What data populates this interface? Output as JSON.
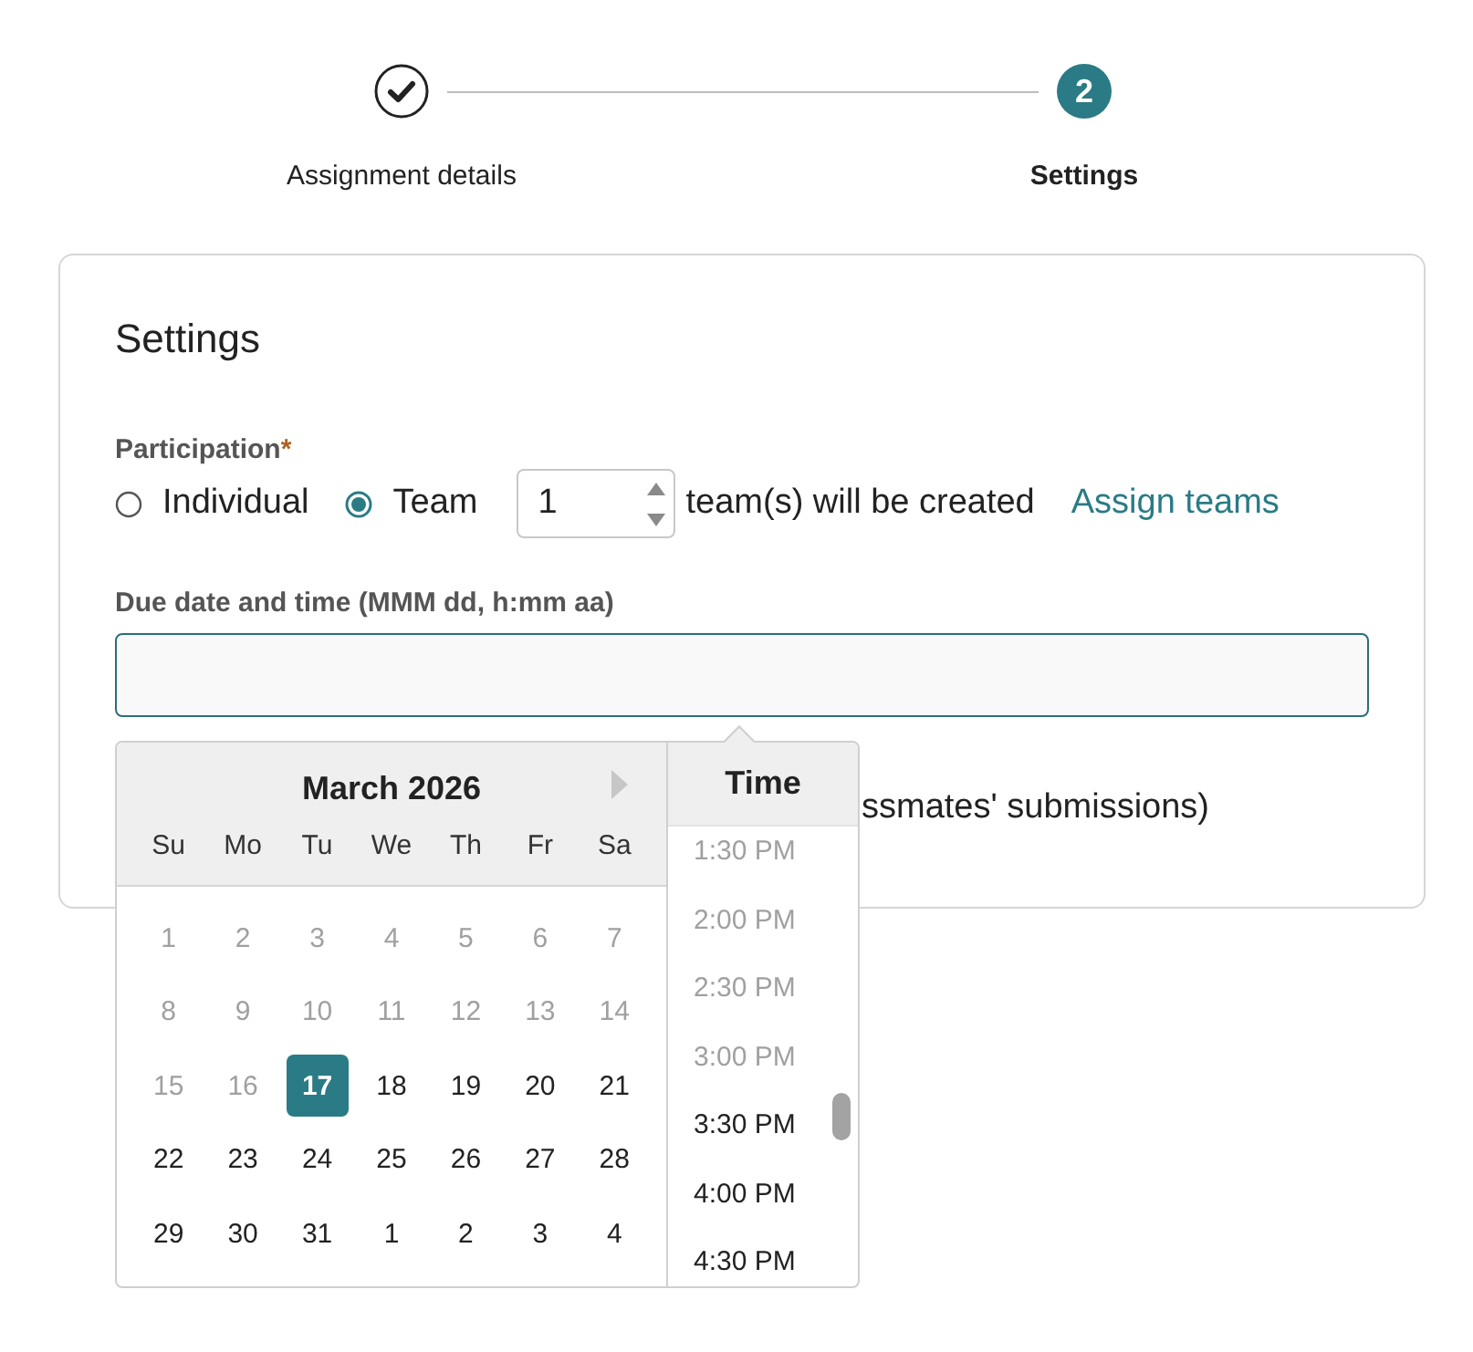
{
  "stepper": {
    "steps": [
      {
        "label": "Assignment details",
        "kind": "completed"
      },
      {
        "label": "Settings",
        "number": "2",
        "kind": "current"
      }
    ]
  },
  "settings": {
    "title": "Settings",
    "participation": {
      "label": "Participation",
      "required_mark": "*",
      "options": [
        {
          "label": "Individual",
          "selected": false
        },
        {
          "label": "Team",
          "selected": true
        }
      ],
      "team_count": "1",
      "team_note": "team(s) will be created",
      "assign_link": "Assign teams"
    },
    "due_date": {
      "label": "Due date and time (MMM dd, h:mm aa)"
    },
    "partly_hidden_option": "ssmates' submissions)"
  },
  "date_picker": {
    "month": "March 2026",
    "weekdays": [
      "Su",
      "Mo",
      "Tu",
      "We",
      "Th",
      "Fr",
      "Sa"
    ],
    "days": [
      {
        "label": "1",
        "disabled": true,
        "selected": false
      },
      {
        "label": "2",
        "disabled": true,
        "selected": false
      },
      {
        "label": "3",
        "disabled": true,
        "selected": false
      },
      {
        "label": "4",
        "disabled": true,
        "selected": false
      },
      {
        "label": "5",
        "disabled": true,
        "selected": false
      },
      {
        "label": "6",
        "disabled": true,
        "selected": false
      },
      {
        "label": "7",
        "disabled": true,
        "selected": false
      },
      {
        "label": "8",
        "disabled": true,
        "selected": false
      },
      {
        "label": "9",
        "disabled": true,
        "selected": false
      },
      {
        "label": "10",
        "disabled": true,
        "selected": false
      },
      {
        "label": "11",
        "disabled": true,
        "selected": false
      },
      {
        "label": "12",
        "disabled": true,
        "selected": false
      },
      {
        "label": "13",
        "disabled": true,
        "selected": false
      },
      {
        "label": "14",
        "disabled": true,
        "selected": false
      },
      {
        "label": "15",
        "disabled": true,
        "selected": false
      },
      {
        "label": "16",
        "disabled": true,
        "selected": false
      },
      {
        "label": "17",
        "disabled": false,
        "selected": true
      },
      {
        "label": "18",
        "disabled": false,
        "selected": false
      },
      {
        "label": "19",
        "disabled": false,
        "selected": false
      },
      {
        "label": "20",
        "disabled": false,
        "selected": false
      },
      {
        "label": "21",
        "disabled": false,
        "selected": false
      },
      {
        "label": "22",
        "disabled": false,
        "selected": false
      },
      {
        "label": "23",
        "disabled": false,
        "selected": false
      },
      {
        "label": "24",
        "disabled": false,
        "selected": false
      },
      {
        "label": "25",
        "disabled": false,
        "selected": false
      },
      {
        "label": "26",
        "disabled": false,
        "selected": false
      },
      {
        "label": "27",
        "disabled": false,
        "selected": false
      },
      {
        "label": "28",
        "disabled": false,
        "selected": false
      },
      {
        "label": "29",
        "disabled": false,
        "selected": false
      },
      {
        "label": "30",
        "disabled": false,
        "selected": false
      },
      {
        "label": "31",
        "disabled": false,
        "selected": false
      },
      {
        "label": "1",
        "disabled": false,
        "selected": false
      },
      {
        "label": "2",
        "disabled": false,
        "selected": false
      },
      {
        "label": "3",
        "disabled": false,
        "selected": false
      },
      {
        "label": "4",
        "disabled": false,
        "selected": false
      }
    ],
    "time_header": "Time",
    "times": [
      {
        "label": "1:30 PM",
        "disabled": true
      },
      {
        "label": "2:00 PM",
        "disabled": true
      },
      {
        "label": "2:30 PM",
        "disabled": true
      },
      {
        "label": "3:00 PM",
        "disabled": true
      },
      {
        "label": "3:30 PM",
        "disabled": false
      },
      {
        "label": "4:00 PM",
        "disabled": false
      },
      {
        "label": "4:30 PM",
        "disabled": false
      }
    ]
  }
}
